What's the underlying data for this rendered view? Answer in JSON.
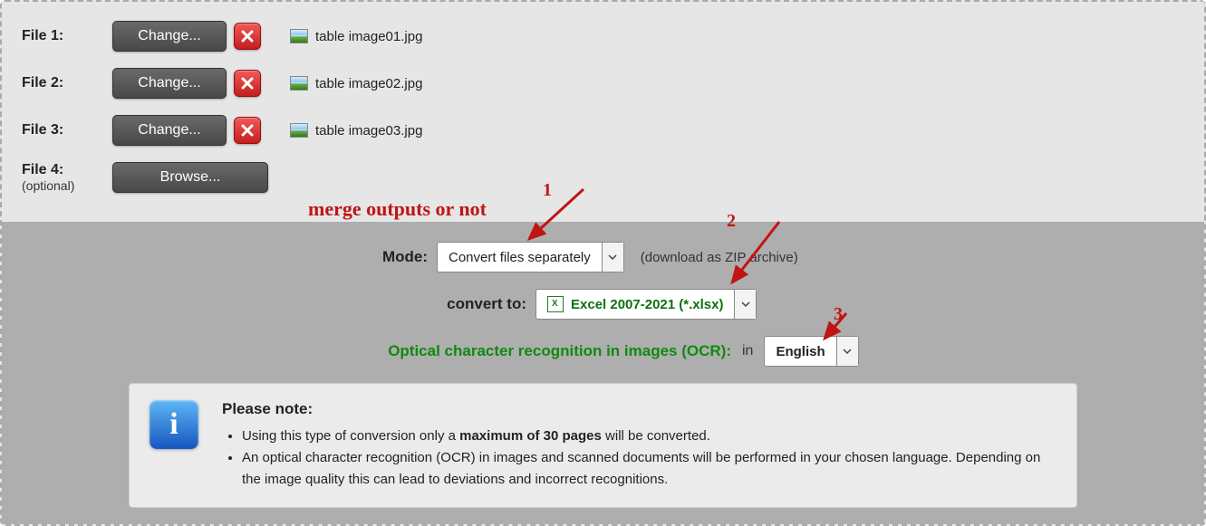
{
  "files": [
    {
      "label": "File 1:",
      "button": "Change...",
      "has_remove": true,
      "name": "table image01.jpg"
    },
    {
      "label": "File 2:",
      "button": "Change...",
      "has_remove": true,
      "name": "table image02.jpg"
    },
    {
      "label": "File 3:",
      "button": "Change...",
      "has_remove": true,
      "name": "table image03.jpg"
    },
    {
      "label": "File 4:",
      "sublabel": "(optional)",
      "button": "Browse...",
      "has_remove": false,
      "name": ""
    }
  ],
  "mode": {
    "label": "Mode:",
    "selected": "Convert files separately",
    "hint": "(download as ZIP archive)"
  },
  "convert_to": {
    "label": "convert to:",
    "selected": "Excel 2007-2021 (*.xlsx)"
  },
  "ocr": {
    "label": "Optical character recognition in images (OCR):",
    "in_word": "in",
    "selected": "English"
  },
  "note": {
    "title": "Please note:",
    "item1_pre": "Using this type of conversion only a ",
    "item1_strong": "maximum of 30 pages",
    "item1_post": " will be converted.",
    "item2": "An optical character recognition (OCR) in images and scanned documents will be performed in your chosen language. Depending on the image quality this can lead to deviations and incorrect recognitions."
  },
  "annotations": {
    "merge_text": "merge outputs or not",
    "n1": "1",
    "n2": "2",
    "n3": "3"
  }
}
